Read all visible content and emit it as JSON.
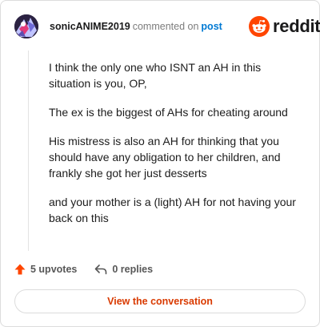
{
  "header": {
    "username": "sonicANIME2019",
    "action_text": "commented on",
    "post_link": "post",
    "brand": "reddit"
  },
  "comment": {
    "paragraphs": [
      "I think the only one who ISNT an AH in this situation is you, OP,",
      "The ex is the biggest of AHs for cheating around",
      "His mistress is also an AH for thinking that you should have any obligation to her children, and frankly she got her just desserts",
      "and your mother is a (light) AH for not having your back on this"
    ]
  },
  "footer": {
    "upvotes_label": "5 upvotes",
    "replies_label": "0 replies"
  },
  "cta": {
    "label": "View the conversation"
  },
  "colors": {
    "brand_orange": "#ff4500",
    "link_blue": "#0079d3",
    "cta_text": "#d93a00"
  },
  "icons": {
    "upvote": "upvote-arrow-icon",
    "reply": "reply-arrow-icon",
    "brand": "reddit-snoo-icon"
  }
}
